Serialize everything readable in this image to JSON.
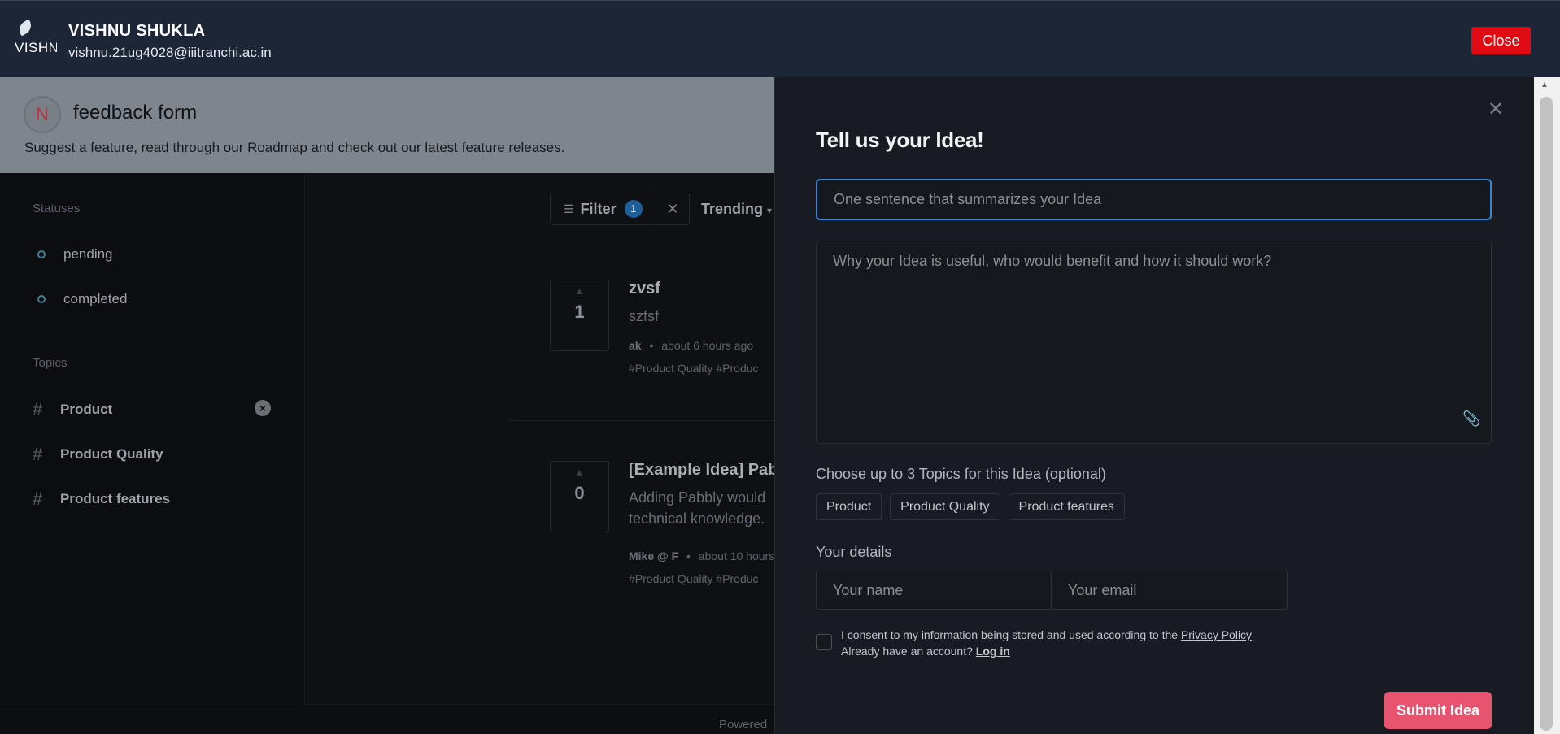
{
  "header": {
    "logo_text": "VISHNU",
    "user_name": "VISHNU SHUKLA",
    "user_email": "vishnu.21ug4028@iiitranchi.ac.in",
    "close_label": "Close"
  },
  "board": {
    "avatar_letter": "N",
    "title": "feedback form",
    "subtitle": "Suggest a feature, read through our Roadmap and check out our latest feature releases."
  },
  "sidebar": {
    "statuses_heading": "Statuses",
    "statuses": [
      "pending",
      "completed"
    ],
    "topics_heading": "Topics",
    "topics": [
      "Product",
      "Product Quality",
      "Product features"
    ]
  },
  "toolbar": {
    "filter_label": "Filter",
    "filter_count": "1",
    "sort_label": "Trending"
  },
  "posts": [
    {
      "votes": "1",
      "title": "zvsf",
      "description": "szfsf",
      "author": "ak",
      "time": "about 6 hours ago",
      "tags": "#Product Quality  #Produc"
    },
    {
      "votes": "0",
      "title": "[Example Idea] Pab",
      "description_line1": "Adding Pabbly would",
      "description_line2": "technical knowledge.",
      "author": "Mike @ F",
      "time": "about 10 hours",
      "tags": "#Product Quality  #Produc"
    }
  ],
  "footer": {
    "powered": "Powered"
  },
  "form": {
    "title": "Tell us your Idea!",
    "summary_placeholder": "One sentence that summarizes your Idea",
    "description_placeholder": "Why your Idea is useful, who would benefit and how it should work?",
    "topics_label": "Choose up to 3 Topics for this Idea (optional)",
    "topic_chips": [
      "Product",
      "Product Quality",
      "Product features"
    ],
    "details_label": "Your details",
    "name_placeholder": "Your name",
    "email_placeholder": "Your email",
    "consent_text": "I consent to my information being stored and used according to the",
    "privacy_link": "Privacy Policy",
    "account_text": "Already have an account?",
    "login_link": "Log in",
    "submit_label": "Submit Idea"
  }
}
